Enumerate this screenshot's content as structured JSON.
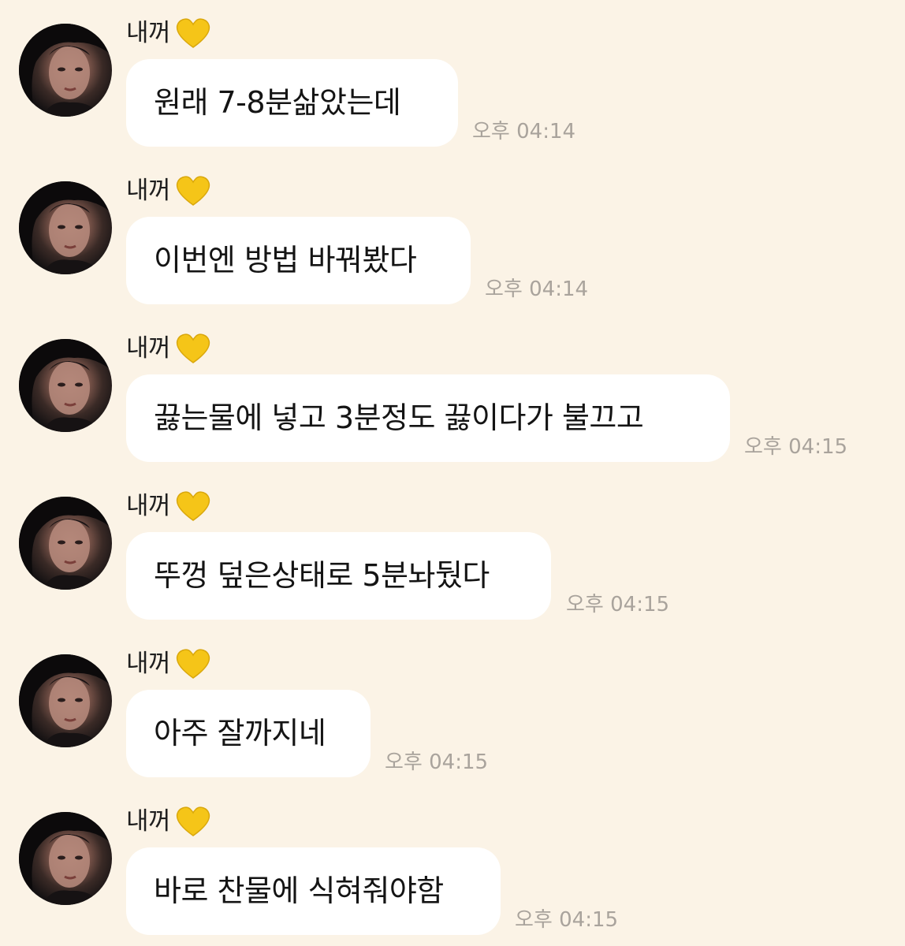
{
  "chat": {
    "messages": [
      {
        "sender": "내꺼",
        "heart_icon": "yellow-heart-icon",
        "text": "원래 7-8분삶았는데",
        "time": "오후 04:14"
      },
      {
        "sender": "내꺼",
        "heart_icon": "yellow-heart-icon",
        "text": "이번엔 방법 바꿔봤다",
        "time": "오후 04:14"
      },
      {
        "sender": "내꺼",
        "heart_icon": "yellow-heart-icon",
        "text": "끓는물에 넣고 3분정도 끓이다가 불끄고",
        "time": "오후 04:15"
      },
      {
        "sender": "내꺼",
        "heart_icon": "yellow-heart-icon",
        "text": "뚜껑 덮은상태로 5분놔뒀다",
        "time": "오후 04:15"
      },
      {
        "sender": "내꺼",
        "heart_icon": "yellow-heart-icon",
        "text": "아주 잘까지네",
        "time": "오후 04:15"
      },
      {
        "sender": "내꺼",
        "heart_icon": "yellow-heart-icon",
        "text": "바로 찬물에 식혀줘야함",
        "time": "오후 04:15"
      }
    ]
  },
  "colors": {
    "background": "#fbf3e6",
    "bubble": "#ffffff",
    "timestamp": "#a9a39c",
    "heart": "#f5c518"
  }
}
